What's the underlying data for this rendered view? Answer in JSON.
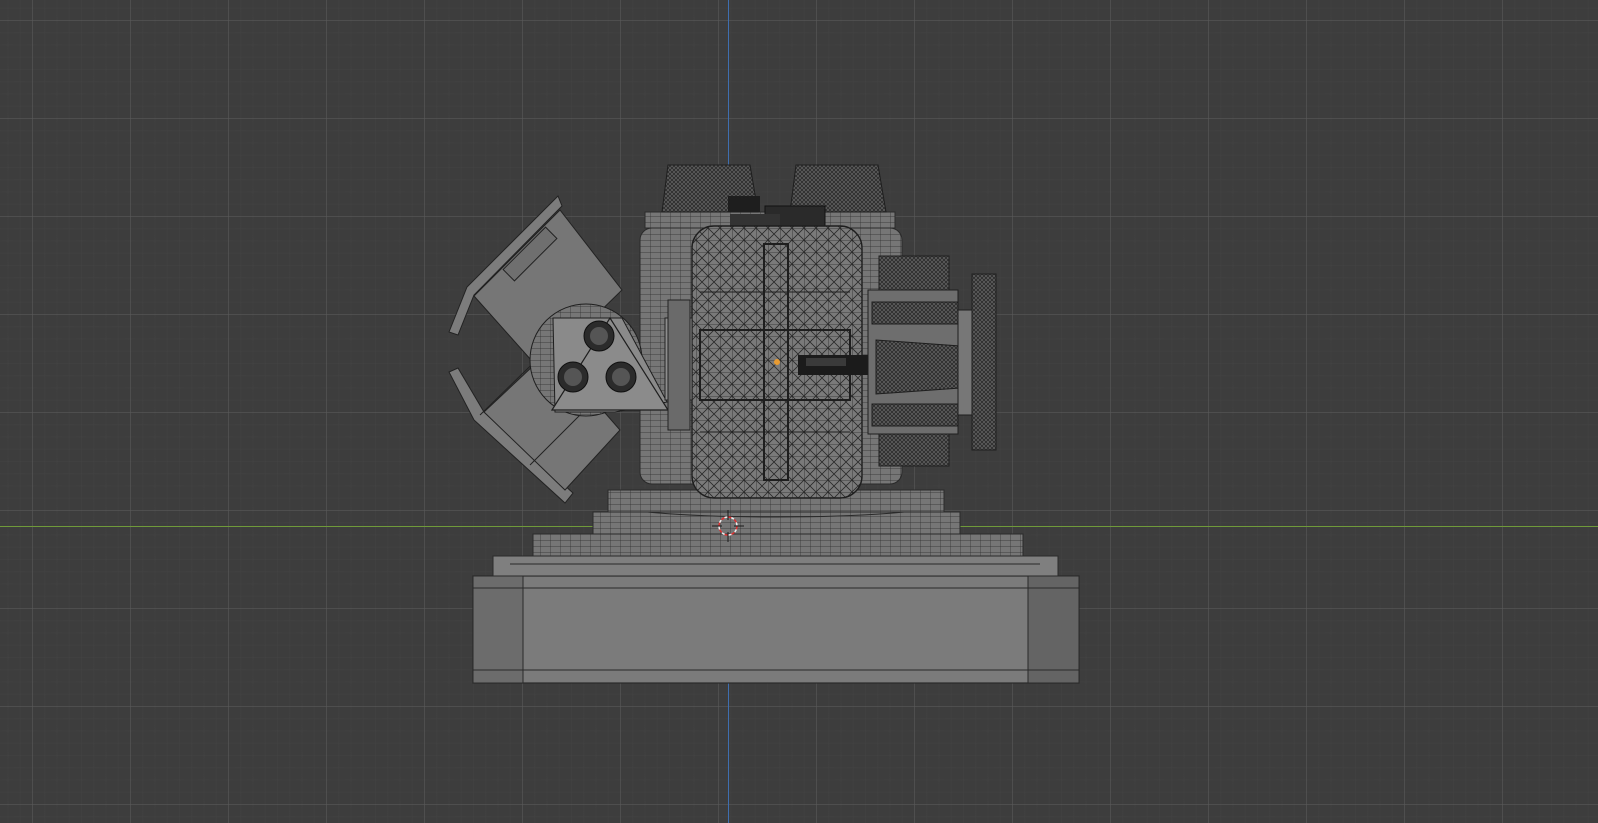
{
  "viewport": {
    "name": "3D Viewport",
    "grid_color": "#5a5a5a",
    "background_color": "#3d3d3d",
    "axis_x_color": "#6f9a3a",
    "axis_z_color": "#3f6fb0"
  },
  "scene": {
    "object": "turret-mesh",
    "display_mode": "wireframe-overlay",
    "cursor": "3d-cursor-icon",
    "origin": "object-origin-dot"
  }
}
